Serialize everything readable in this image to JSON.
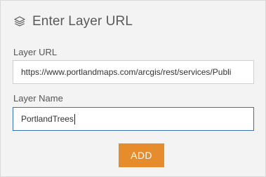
{
  "header": {
    "title": "Enter Layer URL",
    "icon": "layers-icon"
  },
  "form": {
    "url_label": "Layer URL",
    "url_value": "https://www.portlandmaps.com/arcgis/rest/services/Publi",
    "name_label": "Layer Name",
    "name_value": "PortlandTrees"
  },
  "actions": {
    "add_label": "ADD"
  },
  "colors": {
    "panel_bg": "#f3f3f3",
    "accent": "#e68c2c",
    "focus_border": "#3a6fb0"
  }
}
